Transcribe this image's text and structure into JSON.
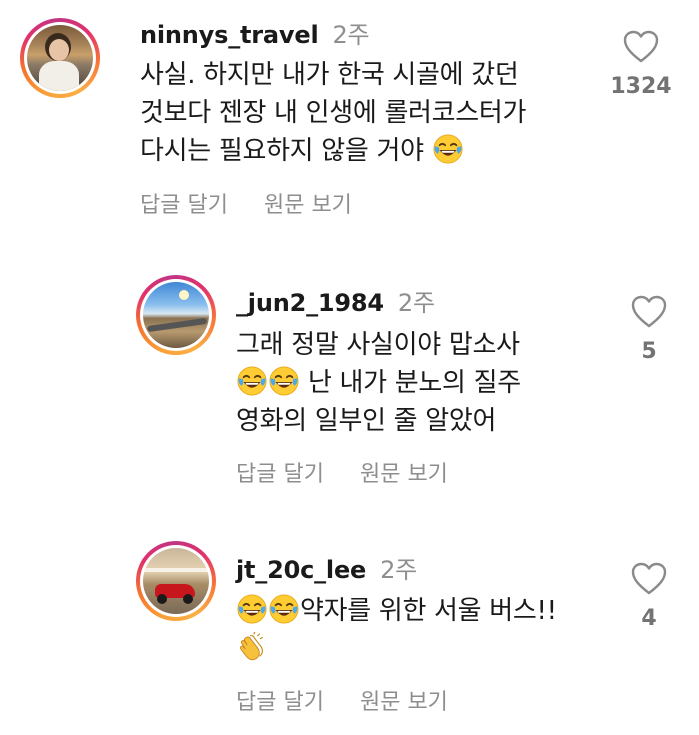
{
  "comments": [
    {
      "username": "ninnys_travel",
      "time": "2주",
      "lines": [
        "사실. 하지만 내가 한국 시골에 갔던",
        "것보다 젠장 내 인생에 롤러코스터가",
        "다시는 필요하지 않을 거야"
      ],
      "reply_label": "답글 달기",
      "translate_label": "원문 보기",
      "likes": "1324"
    },
    {
      "username": "_jun2_1984",
      "time": "2주",
      "lines": [
        "그래 정말 사실이야 맙소사",
        "난 내가 분노의 질주",
        "영화의 일부인 줄 알았어"
      ],
      "reply_label": "답글 달기",
      "translate_label": "원문 보기",
      "likes": "5"
    },
    {
      "username": "jt_20c_lee",
      "time": "2주",
      "lines": [
        "약자를 위한 서울 버스!!"
      ],
      "reply_label": "답글 달기",
      "translate_label": "원문 보기",
      "likes": "4"
    }
  ],
  "icons": {
    "laugh_emoji": "face-with-tears-of-joy",
    "clap_emoji": "clapping-hands",
    "like": "heart-outline-icon"
  }
}
